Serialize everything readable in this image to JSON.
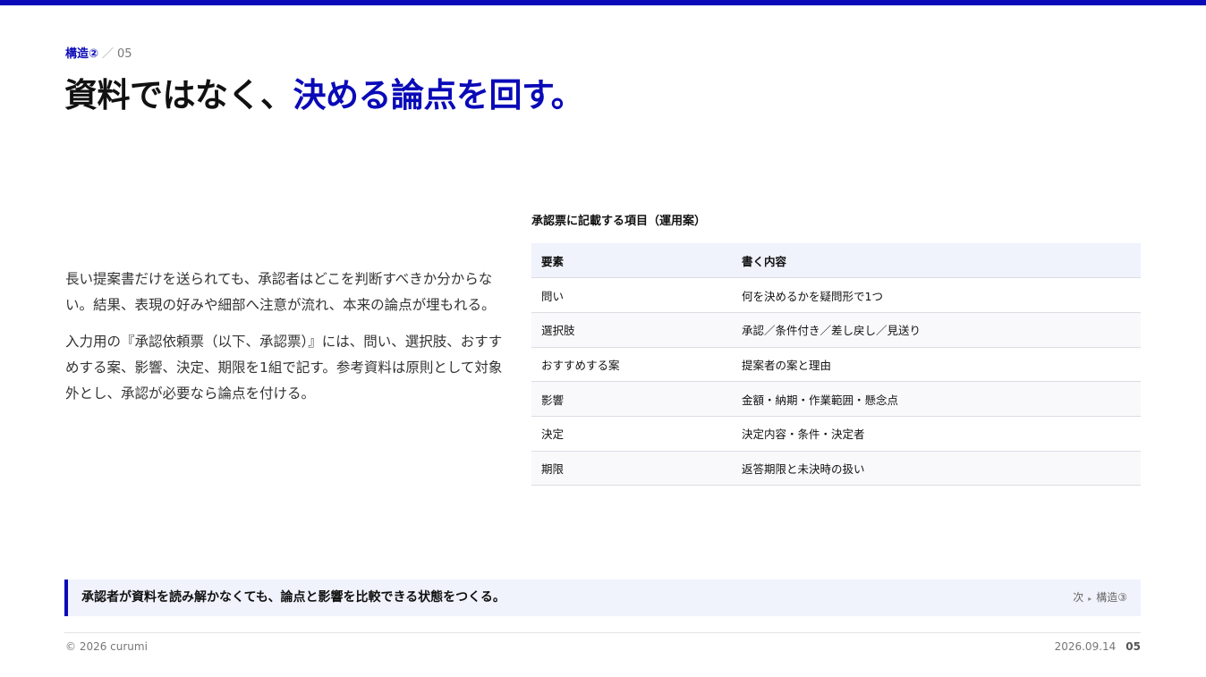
{
  "header": {
    "section_label": "構造②",
    "separator": "／",
    "page_number": "05",
    "title_plain": "資料ではなく、",
    "title_highlight": "決める論点を回す。"
  },
  "body": {
    "paragraph_1": "長い提案書だけを送られても、承認者はどこを判断すべきか分からない。結果、表現の好みや細部へ注意が流れ、本来の論点が埋もれる。",
    "paragraph_2": "入力用の『承認依頼票（以下、承認票）』には、問い、選択肢、おすすめする案、影響、決定、期限を1組で記す。参考資料は原則として対象外とし、承認が必要なら論点を付ける。"
  },
  "table": {
    "caption": "承認票に記載する項目（運用案）",
    "headers": [
      "要素",
      "書く内容"
    ],
    "rows": [
      [
        "問い",
        "何を決めるかを疑問形で1つ"
      ],
      [
        "選択肢",
        "承認／条件付き／差し戻し／見送り"
      ],
      [
        "おすすめする案",
        "提案者の案と理由"
      ],
      [
        "影響",
        "金額・納期・作業範囲・懸念点"
      ],
      [
        "決定",
        "決定内容・条件・決定者"
      ],
      [
        "期限",
        "返答期限と未決時の扱い"
      ]
    ]
  },
  "takeaway": {
    "message": "承認者が資料を読み解かなくても、論点と影響を比較できる状態をつくる。",
    "next_label": "次",
    "next_arrow": "▸",
    "next_section": "構造③"
  },
  "footer": {
    "copyright": "© 2026 curumi",
    "date": "2026.09.14",
    "page": "05"
  },
  "colors": {
    "accent": "#0a0ab8",
    "table_header_bg": "#f0f2fc",
    "takeaway_bg": "#f0f2fc"
  }
}
